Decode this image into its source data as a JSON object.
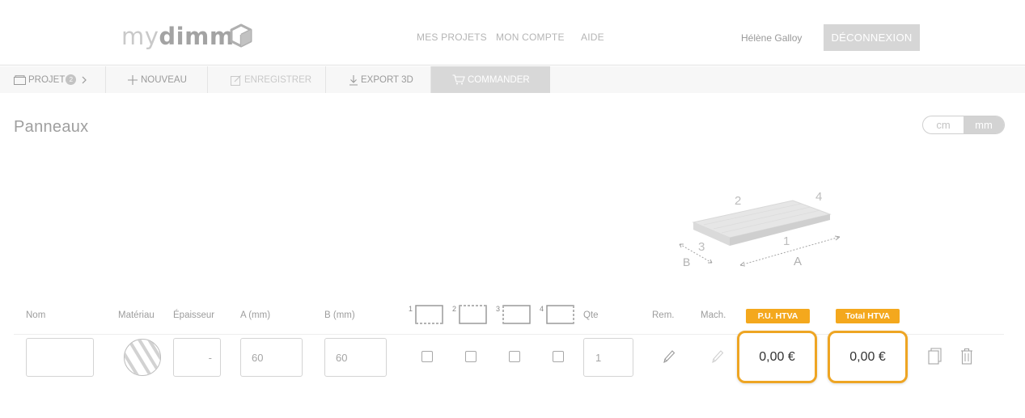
{
  "header": {
    "logo_light": "my",
    "logo_bold": "dimm",
    "nav": [
      "MES PROJETS",
      "MON COMPTE",
      "AIDE"
    ],
    "user_name": "Hélène Galloy",
    "logout_label": "DÉCONNEXION"
  },
  "toolbar": {
    "project_label": "PROJET",
    "project_count": "2",
    "new_label": "NOUVEAU",
    "save_label": "ENREGISTRER",
    "export_label": "EXPORT 3D",
    "order_label": "COMMANDER"
  },
  "page": {
    "title": "Panneaux",
    "units": [
      "cm",
      "mm"
    ],
    "active_unit": "mm"
  },
  "diagram": {
    "edge_labels": [
      "1",
      "2",
      "3",
      "4"
    ],
    "dimension_labels": [
      "A",
      "B"
    ]
  },
  "table": {
    "headers": {
      "name": "Nom",
      "material": "Matériau",
      "thickness": "Épaisseur",
      "a": "A (mm)",
      "b": "B (mm)",
      "edges": [
        "1",
        "2",
        "3",
        "4"
      ],
      "qty": "Qte",
      "rem": "Rem.",
      "mach": "Mach.",
      "unit_price": "P.U. HTVA",
      "total": "Total HTVA"
    },
    "row": {
      "name": "",
      "thickness": "-",
      "a": "60",
      "b": "60",
      "qty": "1",
      "unit_price": "0,00 €",
      "total": "0,00 €"
    }
  },
  "colors": {
    "accent": "#f4a81d",
    "price_border": "#eea523",
    "active_grey": "#d8d8d8"
  }
}
